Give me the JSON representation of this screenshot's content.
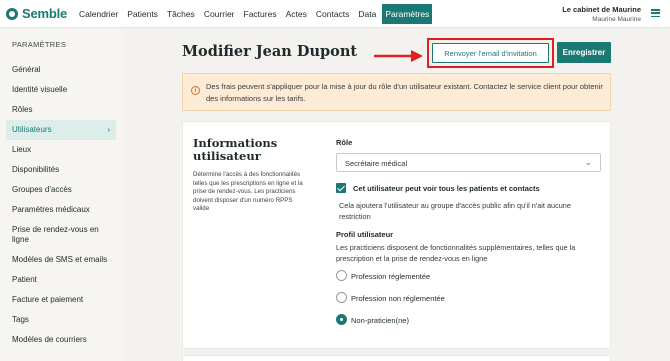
{
  "app": {
    "name": "Semble"
  },
  "nav": {
    "items": [
      "Calendrier",
      "Patients",
      "Tâches",
      "Courrier",
      "Factures",
      "Actes",
      "Contacts",
      "Data",
      "Paramètres"
    ],
    "active": "Paramètres"
  },
  "account": {
    "cabinet": "Le cabinet de Maurine",
    "user": "Maurine Maurine"
  },
  "sidebar": {
    "title": "PARAMÈTRES",
    "items": [
      {
        "label": "Général"
      },
      {
        "label": "Identité visuelle"
      },
      {
        "label": "Rôles"
      },
      {
        "label": "Utilisateurs",
        "active": true
      },
      {
        "label": "Lieux"
      },
      {
        "label": "Disponibilités"
      },
      {
        "label": "Groupes d'accès"
      },
      {
        "label": "Paramètres médicaux"
      },
      {
        "label": "Prise de rendez-vous en ligne"
      },
      {
        "label": "Modèles de SMS et emails"
      },
      {
        "label": "Patient"
      },
      {
        "label": "Facture et paiement"
      },
      {
        "label": "Tags"
      },
      {
        "label": "Modèles de courriers"
      }
    ]
  },
  "page": {
    "title": "Modifier Jean Dupont",
    "resend_button": "Renvoyer l'email d'invitation",
    "save_button": "Enregistrer"
  },
  "alert": {
    "text": "Des frais peuvent s'appliquer pour la mise à jour du rôle d'un utilisateur existant. Contactez le service client pour obtenir des informations sur les tarifs."
  },
  "user_info": {
    "title": "Informations utilisateur",
    "description": "Détermine l'accès à des fonctionnalités telles que les prescriptions en ligne et la prise de rendez-vous. Les practiciens doivent disposer d'un numéro RPPS valide",
    "role_label": "Rôle",
    "role_value": "Secrétaire médical",
    "see_all_patients_label": "Cet utilisateur peut voir tous les patients et contacts",
    "see_all_patients_checked": true,
    "see_all_patients_help": "Cela ajoutera l'utilisateur au groupe d'accès public afin qu'il n'ait aucune restriction",
    "profile_label": "Profil utilisateur",
    "profile_help": "Les practiciens disposent de fonctionnalités supplémentaires, telles que la prescription et la prise de rendez-vous en ligne",
    "profile_options": [
      {
        "label": "Profession réglementée",
        "checked": false
      },
      {
        "label": "Profession non réglementée",
        "checked": false
      },
      {
        "label": "Non-praticien(ne)",
        "checked": true
      }
    ]
  },
  "colors": {
    "brand": "#1a7a73",
    "alert_bg": "#fdebd6",
    "highlight": "#e02020"
  }
}
